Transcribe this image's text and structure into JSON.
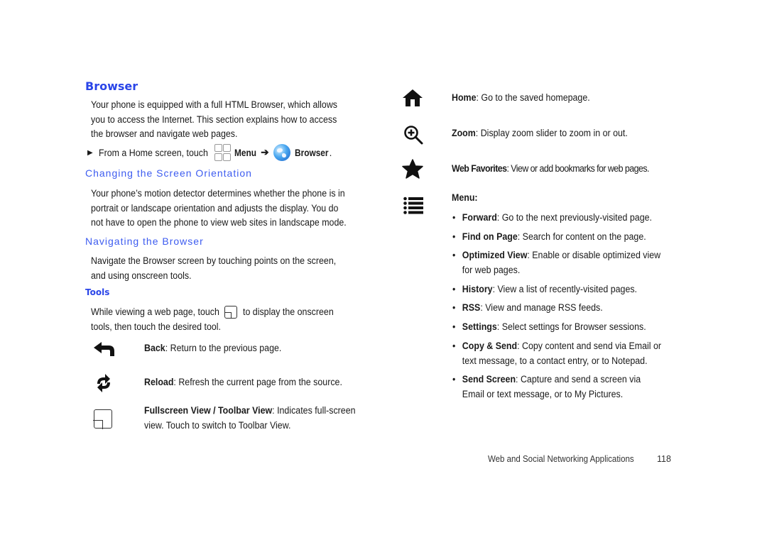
{
  "section": {
    "title": "Browser",
    "intro_lines": [
      "Your phone is equipped with a full HTML Browser, which allows",
      "you to access the Internet. This section explains how to access",
      "the browser and navigate web pages."
    ],
    "step": {
      "prefix": "From a Home screen, touch",
      "menu_label": "Menu",
      "arrow": "➔",
      "browser_label": "Browser",
      "suffix": "."
    }
  },
  "orientation": {
    "heading": "Changing the Screen Orientation",
    "lines": [
      "Your phone’s motion detector determines whether the phone is in",
      "portrait or landscape orientation and adjusts the display. You do",
      "not have to open the phone to view web sites in landscape mode."
    ]
  },
  "navigating": {
    "heading": "Navigating the Browser",
    "lines": [
      "Navigate the Browser screen by touching points on the screen,",
      "and using onscreen tools."
    ]
  },
  "tools": {
    "heading": "Tools",
    "intro_before": "While viewing a web page, touch",
    "intro_after": "to display the onscreen",
    "intro_line2": "tools, then touch the desired tool.",
    "items": [
      {
        "icon": "back-arrow-icon",
        "name": "Back",
        "desc": ": Return to the previous page."
      },
      {
        "icon": "reload-icon",
        "name": "Reload",
        "desc": ": Refresh the current page from the source."
      },
      {
        "icon": "fullscreen-icon",
        "name": "Fullscreen View / Toolbar View",
        "desc": ": Indicates full-screen",
        "desc2": "view.  Touch to switch to Toolbar View."
      }
    ]
  },
  "right_tools": [
    {
      "icon": "home-icon",
      "name": "Home",
      "desc": ": Go to the saved homepage."
    },
    {
      "icon": "zoom-in-icon",
      "name": "Zoom",
      "desc": ": Display zoom slider to zoom in or out."
    },
    {
      "icon": "star-icon",
      "name": "Web Favorites",
      "desc": ": View or add bookmarks for web pages."
    }
  ],
  "menu": {
    "icon": "menu-list-icon",
    "label": "Menu:",
    "items": [
      {
        "name": "Forward",
        "desc": ": Go to the next previously-visited page."
      },
      {
        "name": "Find on Page",
        "desc": ": Search for content on the page."
      },
      {
        "name": "Optimized View",
        "desc": ": Enable or disable optimized view",
        "desc2": "for web pages."
      },
      {
        "name": "History",
        "desc": ": View a list of recently-visited pages."
      },
      {
        "name": "RSS",
        "desc": ": View and manage RSS feeds."
      },
      {
        "name": "Settings",
        "desc": ": Select settings for Browser sessions."
      },
      {
        "name": "Copy & Send",
        "desc": ": Copy content and send via Email or",
        "desc2": "text message, to a contact entry, or to Notepad."
      },
      {
        "name": "Send Screen",
        "desc": ": Capture and send a screen via",
        "desc2": "Email or text message, or to My Pictures."
      }
    ]
  },
  "footer": {
    "chapter": "Web and Social Networking Applications",
    "page_number": "118"
  }
}
